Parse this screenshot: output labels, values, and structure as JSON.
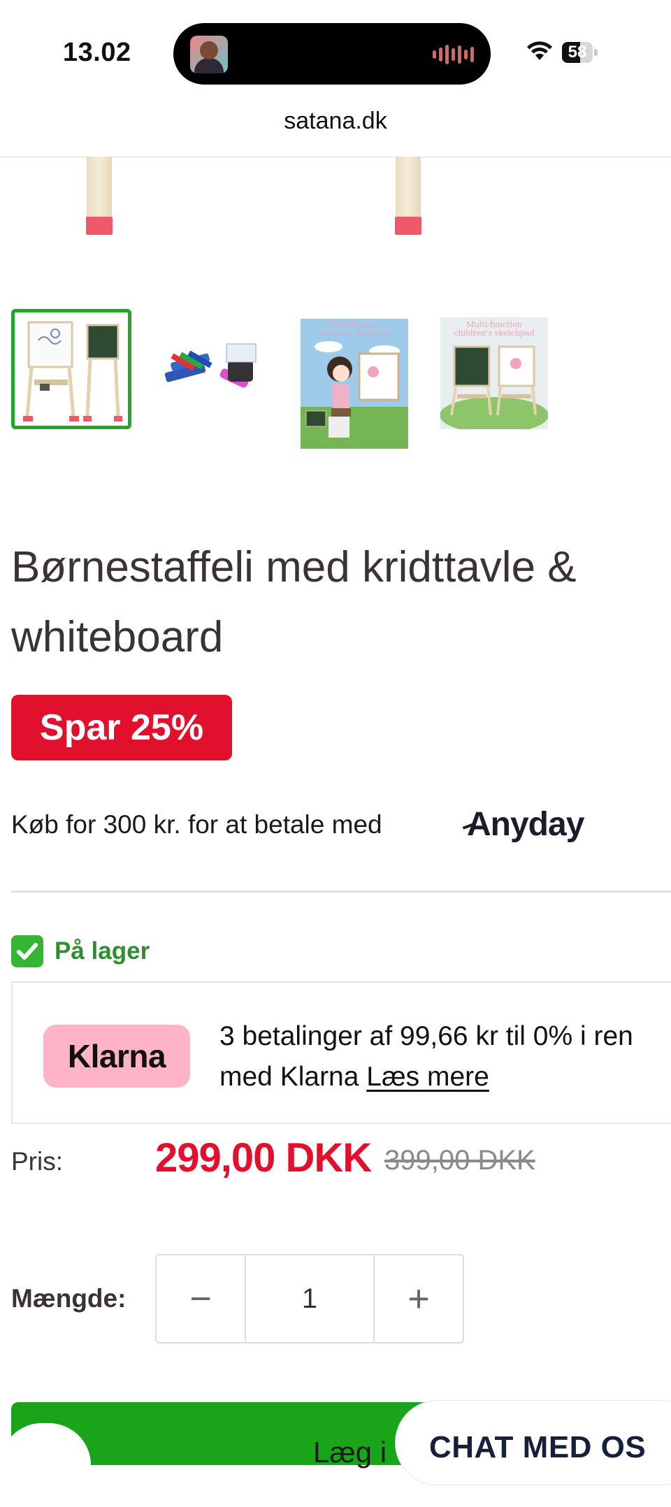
{
  "status_bar": {
    "time": "13.02",
    "battery": "58",
    "battery_level": 0.58
  },
  "browser": {
    "url": "satana.dk"
  },
  "product": {
    "title": "Børnestaffeli med kridttavle & whiteboard",
    "discount_badge": "Spar 25%",
    "anyday_text": "Køb for 300 kr. for at betale med",
    "anyday_logo": "Anyday",
    "stock": "På lager",
    "klarna": {
      "logo": "Klarna",
      "text_line1": "3 betalinger af 99,66 kr til 0% i ren",
      "text_line2": "med Klarna ",
      "link": "Læs mere"
    },
    "price_label": "Pris:",
    "price": "299,00 DKK",
    "price_old": "399,00 DKK",
    "quantity_label": "Mængde:",
    "quantity": "1",
    "qty_minus": "−",
    "qty_plus": "+"
  },
  "footer": {
    "add_to_cart": "Læg i",
    "chat": "CHAT MED OS"
  },
  "colors": {
    "accent_red": "#e1112d",
    "stock_green": "#2f8f2f",
    "cart_green": "#1aa41a",
    "klarna_pink": "#ffb3c7",
    "thumbnail_selected": "#25a52a"
  },
  "icons": {
    "stock": "check-mark-icon",
    "wifi": "wifi-icon",
    "battery": "battery-icon"
  }
}
